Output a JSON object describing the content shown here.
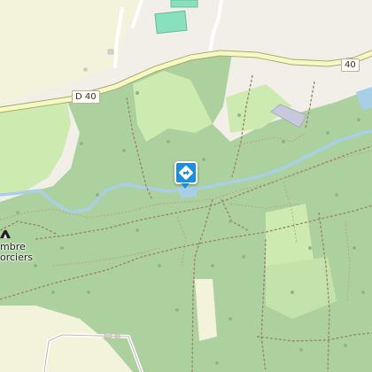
{
  "map": {
    "roads": [
      {
        "ref": "D 40",
        "label_text": "D 40"
      },
      {
        "ref": "40",
        "label_text": "40"
      }
    ],
    "places": [
      {
        "name_line1": "mbre",
        "name_line2": "orciers"
      }
    ],
    "markers": [
      {
        "type": "viewpoint-marker",
        "icon": "direction-sign-icon",
        "color": "#1a8fe0"
      },
      {
        "type": "cave-entrance",
        "icon": "cave-icon"
      }
    ],
    "colors": {
      "background": "#f2efe9",
      "forest": "#add19e",
      "meadow": "#cdebb0",
      "sports_pitch": "#88e0be",
      "parking": "#c8c8dc",
      "road_fill": "#f7fabf",
      "road_casing": "#a9a77c",
      "water": "#a8cfe6",
      "path": "#9a8a6e"
    }
  }
}
